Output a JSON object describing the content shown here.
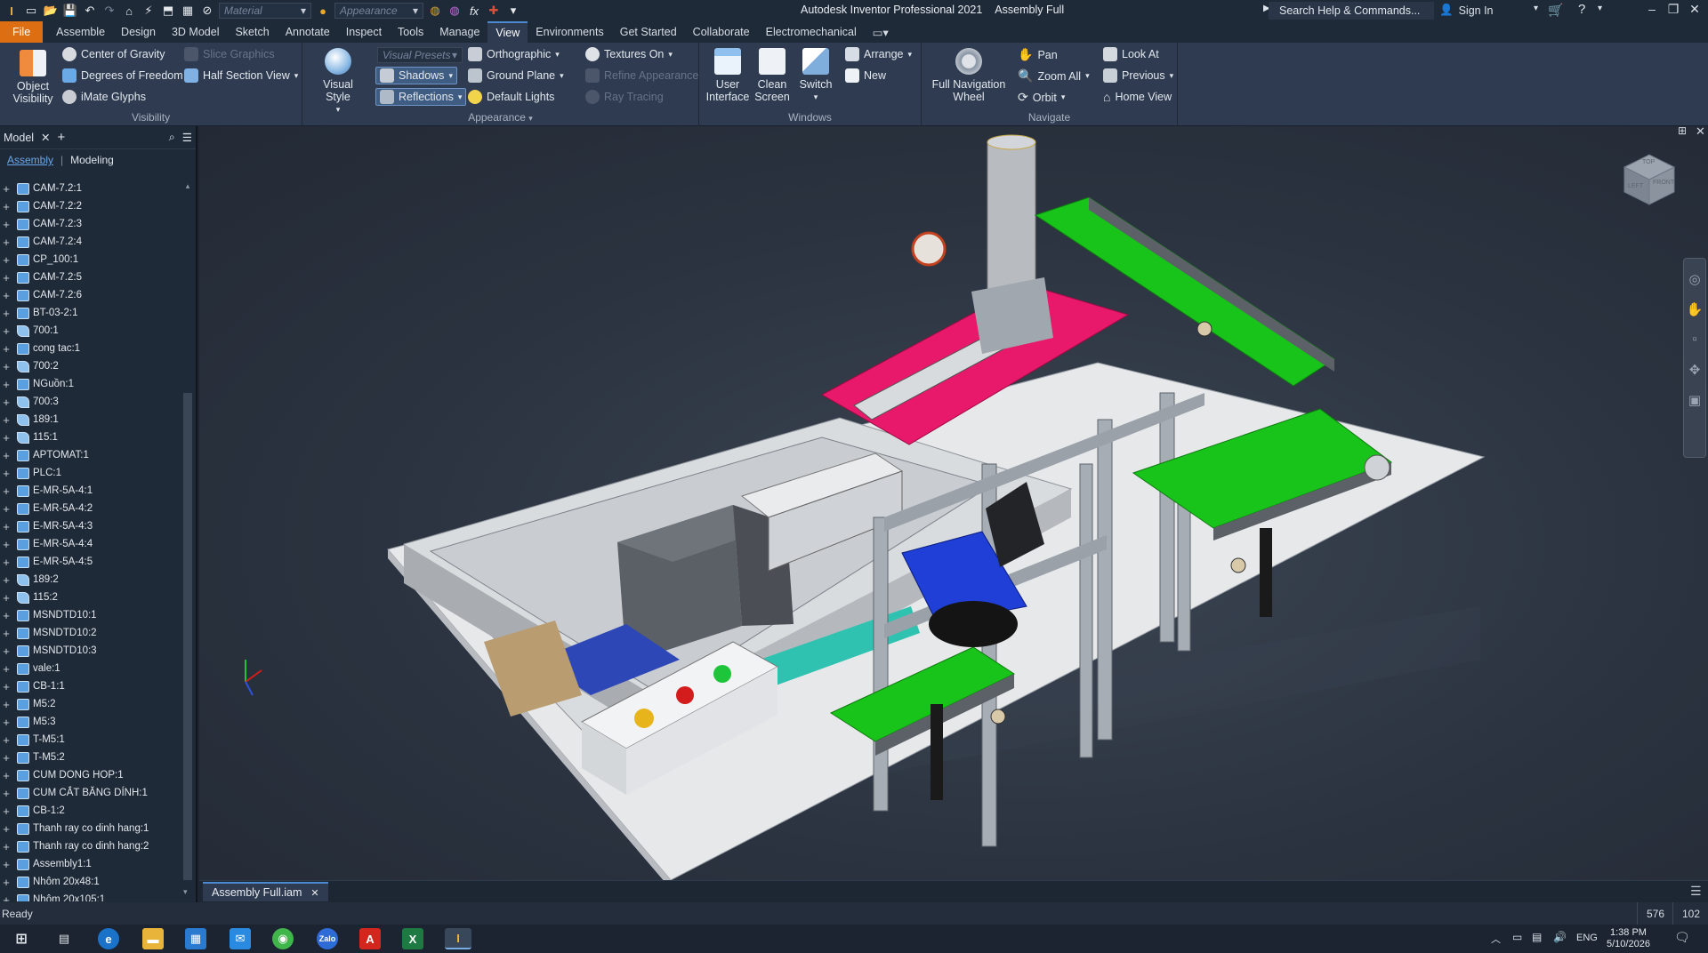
{
  "titlebar": {
    "app": "Autodesk Inventor Professional 2021",
    "document": "Assembly Full",
    "material_placeholder": "Material",
    "appearance_placeholder": "Appearance",
    "search": "Search Help & Commands...",
    "sign_in": "Sign In"
  },
  "menu_tabs": [
    "File",
    "Assemble",
    "Design",
    "3D Model",
    "Sketch",
    "Annotate",
    "Inspect",
    "Tools",
    "Manage",
    "View",
    "Environments",
    "Get Started",
    "Collaborate",
    "Electromechanical"
  ],
  "ribbon": {
    "visibility": {
      "title": "Visibility",
      "object_visibility": "Object Visibility",
      "center_of_gravity": "Center of Gravity",
      "degrees_of_freedom": "Degrees of Freedom",
      "imate_glyphs": "iMate Glyphs",
      "slice_graphics": "Slice Graphics",
      "half_section_view": "Half Section View"
    },
    "appearance": {
      "title": "Appearance",
      "visual_style": "Visual Style",
      "visual_presets": "Visual Presets",
      "shadows": "Shadows",
      "reflections": "Reflections",
      "orthographic": "Orthographic",
      "ground_plane": "Ground Plane",
      "default_lights": "Default Lights",
      "textures_on": "Textures On",
      "refine_appearance": "Refine Appearance",
      "ray_tracing": "Ray Tracing"
    },
    "windows": {
      "title": "Windows",
      "user_interface": "User Interface",
      "clean_screen": "Clean Screen",
      "switch": "Switch",
      "arrange": "Arrange",
      "new": "New"
    },
    "navigate": {
      "title": "Navigate",
      "full_nav_wheel": "Full Navigation Wheel",
      "pan": "Pan",
      "zoom_all": "Zoom All",
      "orbit": "Orbit",
      "look_at": "Look At",
      "previous": "Previous",
      "home_view": "Home View"
    }
  },
  "browser": {
    "tab": "Model",
    "sub_tabs": [
      "Assembly",
      "Modeling"
    ],
    "items": [
      "CAM-7.2:1",
      "CAM-7.2:2",
      "CAM-7.2:3",
      "CAM-7.2:4",
      "CP_100:1",
      "CAM-7.2:5",
      "CAM-7.2:6",
      "BT-03-2:1",
      "700:1",
      "cong tac:1",
      "700:2",
      "NGuồn:1",
      "700:3",
      "189:1",
      "115:1",
      "APTOMAT:1",
      "PLC:1",
      "E-MR-5A-4:1",
      "E-MR-5A-4:2",
      "E-MR-5A-4:3",
      "E-MR-5A-4:4",
      "E-MR-5A-4:5",
      "189:2",
      "115:2",
      "MSNDTD10:1",
      "MSNDTD10:2",
      "MSNDTD10:3",
      "vale:1",
      "CB-1:1",
      "M5:2",
      "M5:3",
      "T-M5:1",
      "T-M5:2",
      "CUM DONG HOP:1",
      "CUM CẮT BĂNG DÍNH:1",
      "CB-1:2",
      "Thanh ray co dinh hang:1",
      "Thanh ray co dinh hang:2",
      "Assembly1:1",
      "Nhôm 20x48:1",
      "Nhôm 20x105:1"
    ],
    "part_items": [
      "700:1",
      "700:2",
      "700:3",
      "189:1",
      "115:1",
      "189:2",
      "115:2"
    ]
  },
  "viewcube": {
    "top": "TOP",
    "left": "LEFT",
    "front": "FRONT"
  },
  "document_tab": "Assembly Full.iam",
  "status": {
    "text": "Ready",
    "count1": "576",
    "count2": "102"
  },
  "taskbar": {
    "lang": "ENG",
    "time": "1:38 PM",
    "date": "5/10/2026"
  },
  "colors": {
    "file_tab": "#dd6f12",
    "conveyor": "#18c41a",
    "pink_plate": "#e8186a",
    "blue_part": "#1f3fd6",
    "ribbon": "#2e3b50"
  }
}
